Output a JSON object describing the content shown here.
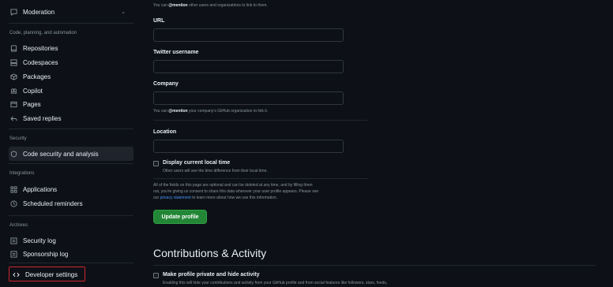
{
  "sidebar": {
    "moderation": "Moderation",
    "sections": {
      "code": "Code, planning, and automation",
      "security": "Security",
      "integrations": "Integrations",
      "archives": "Archives"
    },
    "items": {
      "repositories": "Repositories",
      "codespaces": "Codespaces",
      "packages": "Packages",
      "copilot": "Copilot",
      "pages": "Pages",
      "saved_replies": "Saved replies",
      "code_security": "Code security and analysis",
      "applications": "Applications",
      "scheduled_reminders": "Scheduled reminders",
      "security_log": "Security log",
      "sponsorship_log": "Sponsorship log",
      "developer_settings": "Developer settings"
    }
  },
  "form": {
    "mention_hint_prefix": "You can ",
    "mention_hint_bold": "@mention",
    "mention_hint_suffix": " other users and organizations to link to them.",
    "url_label": "URL",
    "url_value": "",
    "twitter_label": "Twitter username",
    "twitter_value": "",
    "company_label": "Company",
    "company_value": "",
    "company_hint_prefix": "You can ",
    "company_hint_bold": "@mention",
    "company_hint_suffix": " your company's GitHub organization to link it.",
    "location_label": "Location",
    "location_value": "",
    "local_time_label": "Display current local time",
    "local_time_hint": "Other users will see the time difference from their local time.",
    "note_line1": "All of the fields on this page are optional and can be deleted at any time, and by filling them",
    "note_line2": "out, you're giving us consent to share this data wherever your user profile appears. Please see",
    "note_line3_prefix": "our ",
    "note_link": "privacy statement",
    "note_line3_suffix": " to learn more about how we use this information.",
    "update_button": "Update profile"
  },
  "contributions": {
    "heading": "Contributions & Activity",
    "private_label": "Make profile private and hide activity",
    "private_hint": "Enabling this will hide your contributions and activity from your GitHub profile and from social features like followers, stars, feeds,"
  },
  "colors": {
    "background": "#0d1117",
    "accent_green": "#238636",
    "link_blue": "#4493f8",
    "highlight_red": "#d0262d"
  }
}
